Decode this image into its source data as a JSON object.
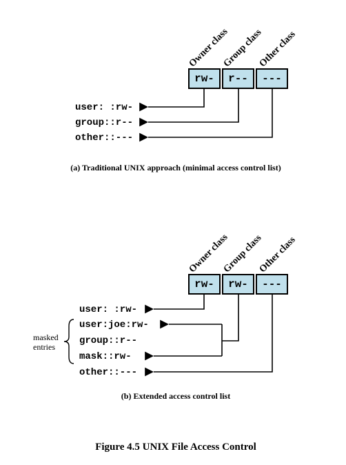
{
  "diagram_a": {
    "labels": {
      "owner": "Owner class",
      "group": "Group class",
      "other": "Other class"
    },
    "cells": {
      "owner": "rw-",
      "group": "r--",
      "other": "---"
    },
    "entries": {
      "user": "user: :rw-",
      "group": "group::r--",
      "other": "other::---"
    },
    "caption": "(a) Traditional UNIX approach (minimal access control list)"
  },
  "diagram_b": {
    "labels": {
      "owner": "Owner class",
      "group": "Group class",
      "other": "Other class"
    },
    "cells": {
      "owner": "rw-",
      "group": "rw-",
      "other": "---"
    },
    "entries": {
      "user": "user: :rw-",
      "userjoe": "user:joe:rw-",
      "group": "group::r--",
      "mask": "mask::rw-",
      "other": "other::---"
    },
    "masked_label": {
      "line1": "masked",
      "line2": "entries"
    },
    "caption": "(b) Extended access control list"
  },
  "figure_caption": "Figure 4.5   UNIX File Access Control"
}
